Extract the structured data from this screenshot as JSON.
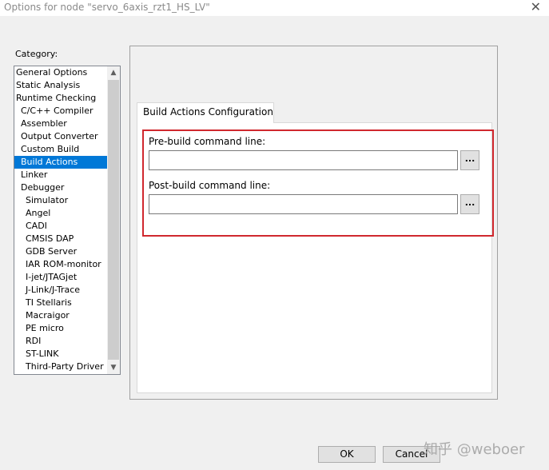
{
  "window": {
    "title": "Options for node \"servo_6axis_rzt1_HS_LV\"",
    "close_glyph": "✕"
  },
  "category": {
    "label": "Category:",
    "items": [
      {
        "label": "General Options",
        "level": 0
      },
      {
        "label": "Static Analysis",
        "level": 0
      },
      {
        "label": "Runtime Checking",
        "level": 0
      },
      {
        "label": "C/C++ Compiler",
        "level": 1
      },
      {
        "label": "Assembler",
        "level": 1
      },
      {
        "label": "Output Converter",
        "level": 1
      },
      {
        "label": "Custom Build",
        "level": 1
      },
      {
        "label": "Build Actions",
        "level": 1,
        "selected": true
      },
      {
        "label": "Linker",
        "level": 1
      },
      {
        "label": "Debugger",
        "level": 1
      },
      {
        "label": "Simulator",
        "level": 2
      },
      {
        "label": "Angel",
        "level": 2
      },
      {
        "label": "CADI",
        "level": 2
      },
      {
        "label": "CMSIS DAP",
        "level": 2
      },
      {
        "label": "GDB Server",
        "level": 2
      },
      {
        "label": "IAR ROM-monitor",
        "level": 2
      },
      {
        "label": "I-jet/JTAGjet",
        "level": 2
      },
      {
        "label": "J-Link/J-Trace",
        "level": 2
      },
      {
        "label": "TI Stellaris",
        "level": 2
      },
      {
        "label": "Macraigor",
        "level": 2
      },
      {
        "label": "PE micro",
        "level": 2
      },
      {
        "label": "RDI",
        "level": 2
      },
      {
        "label": "ST-LINK",
        "level": 2
      },
      {
        "label": "Third-Party Driver",
        "level": 2
      }
    ],
    "scroll_up_glyph": "▲",
    "scroll_down_glyph": "▼"
  },
  "tab": {
    "label": "Build Actions Configuration"
  },
  "pre_build": {
    "label": "Pre-build command line:",
    "value": "",
    "browse_label": "..."
  },
  "post_build": {
    "label": "Post-build command line:",
    "value": "",
    "browse_label": "..."
  },
  "buttons": {
    "ok": "OK",
    "cancel": "Cancel"
  },
  "watermark": "知乎 @weboer",
  "colors": {
    "selection": "#0078d7",
    "highlight_box": "#d0282e"
  }
}
